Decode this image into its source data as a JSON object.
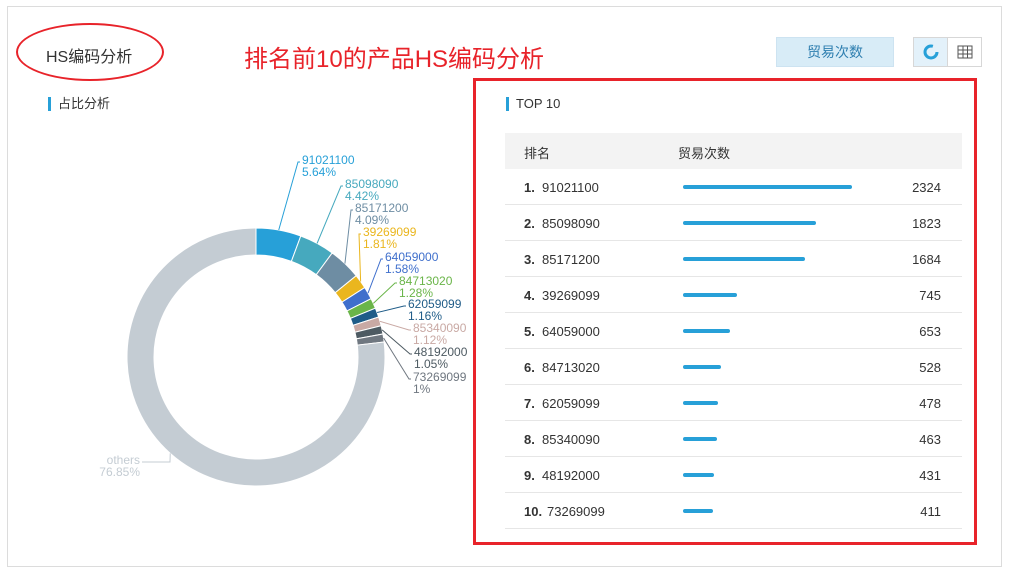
{
  "header": {
    "title": "HS编码分析",
    "annotation": "排名前10的产品HS编码分析",
    "metric_button": "贸易次数",
    "view_toggle": {
      "active": "donut-chart-icon",
      "icons": [
        "donut-chart-icon",
        "table-grid-icon"
      ]
    }
  },
  "pie_section": {
    "label": "占比分析"
  },
  "top_section": {
    "label": "TOP 10",
    "col_rank": "排名",
    "col_count": "贸易次数"
  },
  "colors": {
    "accent": "#27a0d8",
    "annotation_red": "#e8232a"
  },
  "chart_data": [
    {
      "type": "pie",
      "variant": "donut",
      "slices": [
        {
          "label": "91021100",
          "pct_label": "5.64%",
          "value": 5.64,
          "color": "#27a0d8"
        },
        {
          "label": "85098090",
          "pct_label": "4.42%",
          "value": 4.42,
          "color": "#46a9be"
        },
        {
          "label": "85171200",
          "pct_label": "4.09%",
          "value": 4.09,
          "color": "#6e8da3"
        },
        {
          "label": "39269099",
          "pct_label": "1.81%",
          "value": 1.81,
          "color": "#eab61e"
        },
        {
          "label": "64059000",
          "pct_label": "1.58%",
          "value": 1.58,
          "color": "#3f6fcc"
        },
        {
          "label": "84713020",
          "pct_label": "1.28%",
          "value": 1.28,
          "color": "#6ab549"
        },
        {
          "label": "62059099",
          "pct_label": "1.16%",
          "value": 1.16,
          "color": "#1f5c88"
        },
        {
          "label": "85340090",
          "pct_label": "1.12%",
          "value": 1.12,
          "color": "#c9a9a4"
        },
        {
          "label": "48192000",
          "pct_label": "1.05%",
          "value": 1.05,
          "color": "#4d5a62"
        },
        {
          "label": "73269099",
          "pct_label": "1%",
          "value": 1.0,
          "color": "#6f7780"
        },
        {
          "label": "others",
          "pct_label": "76.85%",
          "value": 76.85,
          "color": "#c4ccd3"
        }
      ]
    },
    {
      "type": "bar",
      "orientation": "horizontal",
      "title": "TOP 10",
      "rows": [
        {
          "rank": "1.",
          "code": "91021100",
          "value": 2324
        },
        {
          "rank": "2.",
          "code": "85098090",
          "value": 1823
        },
        {
          "rank": "3.",
          "code": "85171200",
          "value": 1684
        },
        {
          "rank": "4.",
          "code": "39269099",
          "value": 745
        },
        {
          "rank": "5.",
          "code": "64059000",
          "value": 653
        },
        {
          "rank": "6.",
          "code": "84713020",
          "value": 528
        },
        {
          "rank": "7.",
          "code": "62059099",
          "value": 478
        },
        {
          "rank": "8.",
          "code": "85340090",
          "value": 463
        },
        {
          "rank": "9.",
          "code": "48192000",
          "value": 431
        },
        {
          "rank": "10.",
          "code": "73269099",
          "value": 411
        }
      ]
    }
  ]
}
